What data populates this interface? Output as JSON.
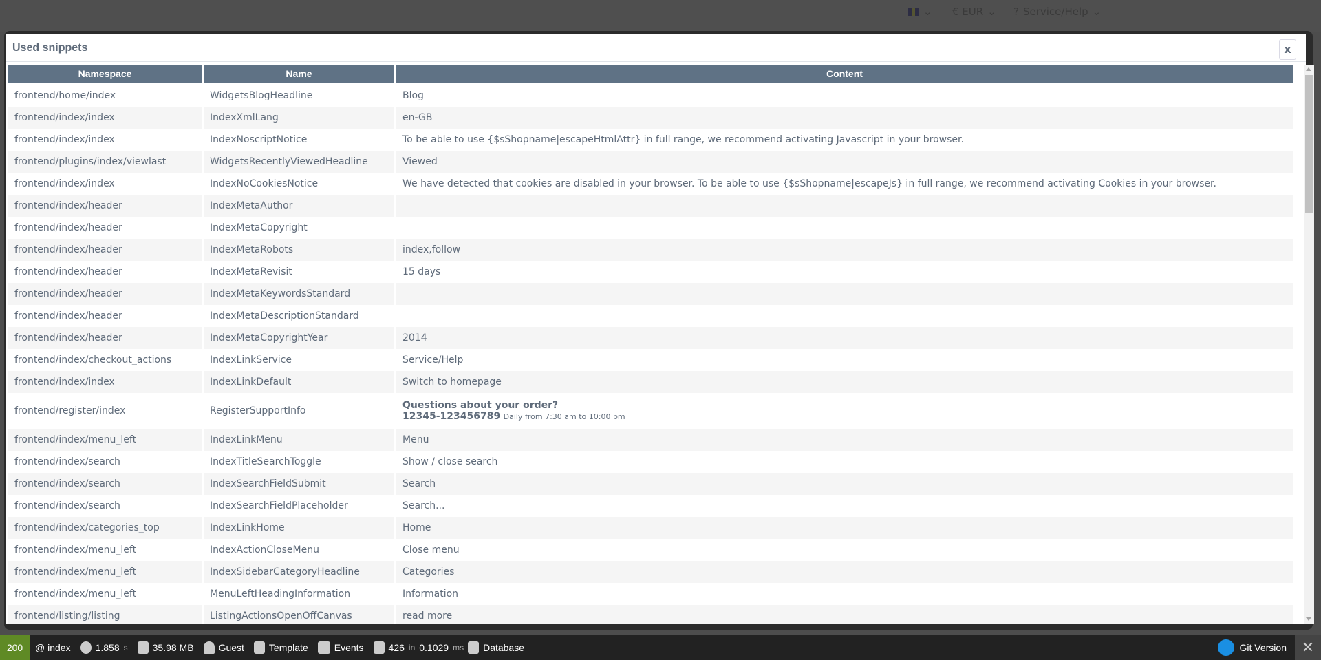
{
  "topbar": {
    "currency": "€ EUR",
    "service": "Service/Help",
    "language_icon": "uk-flag-icon"
  },
  "modal": {
    "title": "Used snippets",
    "close": "x",
    "columns": [
      "Namespace",
      "Name",
      "Content"
    ],
    "rows": [
      [
        "frontend/home/index",
        "WidgetsBlogHeadline",
        "Blog"
      ],
      [
        "frontend/index/index",
        "IndexXmlLang",
        "en-GB"
      ],
      [
        "frontend/index/index",
        "IndexNoscriptNotice",
        "To be able to use {$sShopname|escapeHtmlAttr} in full range, we recommend activating Javascript in your browser."
      ],
      [
        "frontend/plugins/index/viewlast",
        "WidgetsRecentlyViewedHeadline",
        "Viewed"
      ],
      [
        "frontend/index/index",
        "IndexNoCookiesNotice",
        "We have detected that cookies are disabled in your browser. To be able to use {$sShopname|escapeJs} in full range, we recommend activating Cookies in your browser."
      ],
      [
        "frontend/index/header",
        "IndexMetaAuthor",
        ""
      ],
      [
        "frontend/index/header",
        "IndexMetaCopyright",
        ""
      ],
      [
        "frontend/index/header",
        "IndexMetaRobots",
        "index,follow"
      ],
      [
        "frontend/index/header",
        "IndexMetaRevisit",
        "15 days"
      ],
      [
        "frontend/index/header",
        "IndexMetaKeywordsStandard",
        ""
      ],
      [
        "frontend/index/header",
        "IndexMetaDescriptionStandard",
        ""
      ],
      [
        "frontend/index/header",
        "IndexMetaCopyrightYear",
        "2014"
      ],
      [
        "frontend/index/checkout_actions",
        "IndexLinkService",
        "Service/Help"
      ],
      [
        "frontend/index/index",
        "IndexLinkDefault",
        "Switch to homepage"
      ],
      [
        "frontend/register/index",
        "RegisterSupportInfo",
        {
          "line1": "Questions about your order?",
          "phone": "12345-123456789",
          "hours": "Daily from 7:30 am to 10:00 pm"
        }
      ],
      [
        "frontend/index/menu_left",
        "IndexLinkMenu",
        "Menu"
      ],
      [
        "frontend/index/search",
        "IndexTitleSearchToggle",
        "Show / close search"
      ],
      [
        "frontend/index/search",
        "IndexSearchFieldSubmit",
        "Search"
      ],
      [
        "frontend/index/search",
        "IndexSearchFieldPlaceholder",
        "Search..."
      ],
      [
        "frontend/index/categories_top",
        "IndexLinkHome",
        "Home"
      ],
      [
        "frontend/index/menu_left",
        "IndexActionCloseMenu",
        "Close menu"
      ],
      [
        "frontend/index/menu_left",
        "IndexSidebarCategoryHeadline",
        "Categories"
      ],
      [
        "frontend/index/menu_left",
        "MenuLeftHeadingInformation",
        "Information"
      ],
      [
        "frontend/listing/listing",
        "ListingActionsOpenOffCanvas",
        "read more"
      ]
    ]
  },
  "toolbar": {
    "status": "200",
    "route": "@ index",
    "time": "1.858",
    "time_unit": "s",
    "memory": "35.98 MB",
    "user": "Guest",
    "template": "Template",
    "events": "Events",
    "queries": "426",
    "queries_in": "in",
    "query_time": "0.1029",
    "query_unit": "ms",
    "database": "Database",
    "version": "Git Version",
    "close": "✕",
    "accent": "#5f8a25",
    "brand": "#1a8fe3"
  }
}
